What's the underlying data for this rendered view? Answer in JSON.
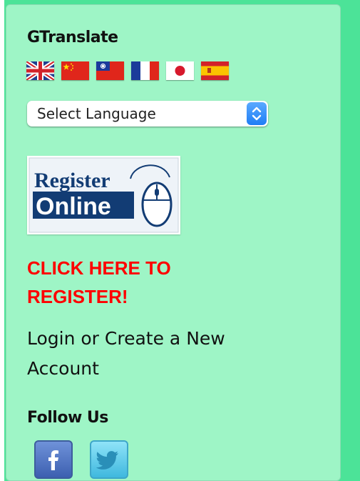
{
  "widget": {
    "title": "GTranslate",
    "flags": [
      "English",
      "Chinese (Simplified)",
      "Chinese (Traditional)",
      "French",
      "Japanese",
      "Spanish"
    ],
    "select": {
      "selected": "Select Language"
    }
  },
  "register": {
    "image_text_top": "Register",
    "image_text_bottom": "Online",
    "cta_line1": "CLICK HERE TO",
    "cta_line2": "REGISTER!",
    "cta_color": "#ff0000"
  },
  "account": {
    "login_line1": "Login or Create a New",
    "login_line2": "Account"
  },
  "follow": {
    "title": "Follow Us",
    "icons": [
      "facebook-icon",
      "twitter-icon"
    ]
  },
  "colors": {
    "page_bg": "#4ce398",
    "panel_bg": "#9ef5c6",
    "select_arrow": "#1f7ef5"
  }
}
